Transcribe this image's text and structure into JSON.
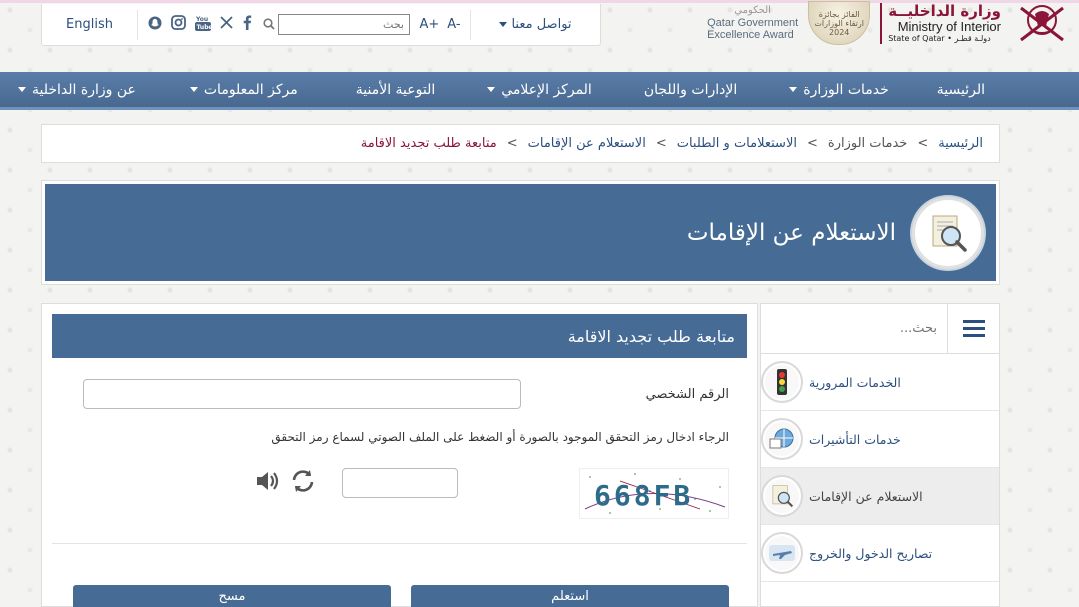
{
  "header": {
    "language_link": "English",
    "search_placeholder": "بحث",
    "font_decrease": "A-",
    "font_increase": "A+",
    "contact_us": "تواصل معنا",
    "award_en_line1": "Qatar Government",
    "award_en_line2": "Excellence Award",
    "award_ar": "الحكومي",
    "award_badge_line1": "الفائز بجائزة",
    "award_badge_line2": "ارتقاء الوزارات",
    "award_badge_year": "2024",
    "ministry_ar": "وزارة الداخليــة",
    "ministry_en": "Ministry of Interior",
    "ministry_sub": "State of Qatar • دولـة قطـر",
    "social_icons": [
      "snapchat-icon",
      "instagram-icon",
      "youtube-icon",
      "x-icon",
      "facebook-icon"
    ]
  },
  "nav": {
    "items": [
      {
        "label": "الرئيسية",
        "dropdown": false
      },
      {
        "label": "خدمات الوزارة",
        "dropdown": true
      },
      {
        "label": "الإدارات واللجان",
        "dropdown": false
      },
      {
        "label": "المركز الإعلامي",
        "dropdown": true
      },
      {
        "label": "التوعية الأمنية",
        "dropdown": false
      },
      {
        "label": "مركز المعلومات",
        "dropdown": true
      },
      {
        "label": "عن وزارة الداخلية",
        "dropdown": true
      }
    ]
  },
  "breadcrumb": {
    "items": [
      "الرئيسية",
      "خدمات الوزارة",
      "الاستعلامات و الطلبات",
      "الاستعلام عن الإقامات"
    ],
    "current": "متابعة طلب تجديد الاقامة",
    "separator": ">"
  },
  "page": {
    "title": "الاستعلام عن الإقامات"
  },
  "sidebar": {
    "search_placeholder": "بحث...",
    "items": [
      {
        "label": "الخدمات المرورية",
        "icon": "traffic-light-icon",
        "active": false
      },
      {
        "label": "خدمات التأشيرات",
        "icon": "visa-globe-icon",
        "active": false
      },
      {
        "label": "الاستعلام عن الإقامات",
        "icon": "magnifier-document-icon",
        "active": true
      },
      {
        "label": "تصاريح الدخول والخروج",
        "icon": "airplane-icon",
        "active": false
      }
    ]
  },
  "form": {
    "heading": "متابعة طلب تجديد الاقامة",
    "id_label": "الرقم الشخصي",
    "captcha_instruction": "الرجاء ادخال رمز التحقق الموجود بالصورة أو الضغط على الملف الصوتي لسماع رمز التحقق",
    "captcha_text": "668FB",
    "inquire_button": "استعلم",
    "clear_button": "مسح"
  },
  "colors": {
    "primary": "#466b94",
    "maroon": "#8a1538",
    "link": "#2b4f7e"
  }
}
